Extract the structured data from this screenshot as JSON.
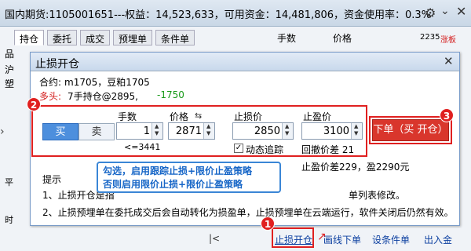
{
  "titlebar": {
    "text": "国内期货:1105001651---权益：14,523,633，可用资金：14,481,806，资金使用率：0.3%",
    "gear_icon": "gear-icon",
    "menu_icon": "chevron-down-icon",
    "close_icon": "close-icon"
  },
  "bg": {
    "tabs": [
      "持仓",
      "委托",
      "成交",
      "预埋单",
      "条件单"
    ],
    "hands_label": "手数",
    "price_label": "价格",
    "code_fragment": "2235",
    "rise_stop": "涨板",
    "rows": [
      "品",
      "沪",
      "塑"
    ],
    "col_frag": [
      "品",
      "合",
      "手数",
      "可用"
    ],
    "ping_frag": "平",
    "shi_frag": "时",
    "pm_frag": "RM609",
    "n_frag": "10",
    "dui_frag": "对手价"
  },
  "dialog": {
    "title": "止损开仓",
    "contract_label": "合约:",
    "contract_value": "m1705，豆粕1705",
    "position_label": "多头:",
    "position_value": "7手持仓@2895,",
    "position_pnl": "-1750",
    "buy": "买",
    "sell": "卖",
    "qty_label": "手数",
    "qty_value": "1",
    "qty_hint": "<=3441",
    "price_label": "价格",
    "price_value": "2871",
    "sl_label": "止损价",
    "sl_value": "2850",
    "tp_label": "止盈价",
    "tp_value": "3100",
    "trail_checked": true,
    "trail_label": "动态追踪",
    "pullback_label": "回撤价差 21",
    "order_button": "下单（买 开仓）",
    "diff_text": "止盈价差229，盈2290元",
    "tip_header": "提示",
    "tip1": "1、止损开仓是指",
    "tip1_end": "单列表修改。",
    "tip2": "2、止损预埋单在委托成交后会自动转化为损盈单，止损预埋单在云端运行，软件关闭后仍然有效。"
  },
  "callout": {
    "line1": "勾选，启用跟踪止损+限价止盈策略",
    "line2": "否则启用限价止损+限价止盈策略"
  },
  "badges": [
    "1",
    "2",
    "3"
  ],
  "bottom": {
    "nav_first": "|<",
    "stop_open": "止损开仓",
    "draw_order": "画线下单",
    "condition_order": "设条件单",
    "deposit": "出入金"
  }
}
